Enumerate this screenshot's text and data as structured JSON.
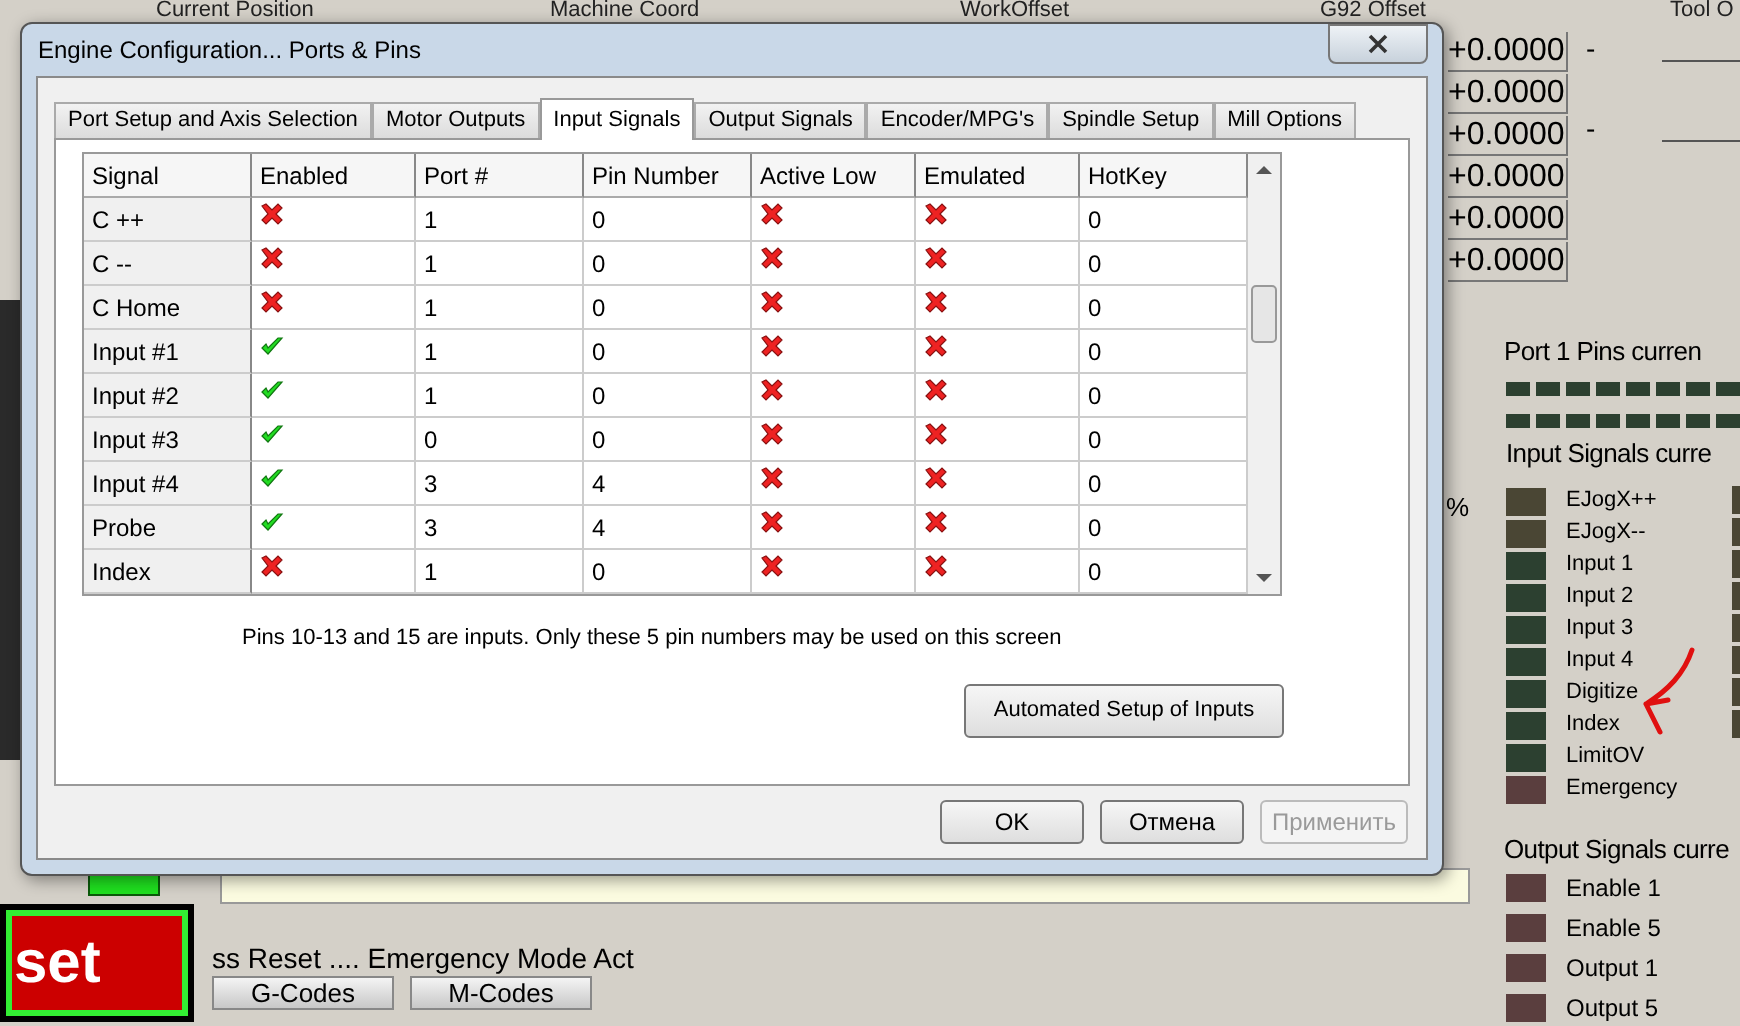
{
  "background_screen": {
    "column_headers": [
      "Current Position",
      "Machine Coord",
      "WorkOffset",
      "G92 Offset",
      "Tool O"
    ],
    "dro_values": [
      "+0.0000",
      "+0.0000",
      "+0.0000",
      "+0.0000",
      "+0.0000",
      "+0.0000"
    ],
    "dashes": [
      "-",
      "-"
    ],
    "port_pins_label": "Port 1 Pins curren",
    "input_signals_label": "Input Signals curre",
    "percent_sign": "%",
    "input_signals": [
      {
        "label": "EJogX++",
        "color": "#4a4634"
      },
      {
        "label": "EJogX--",
        "color": "#4a4634"
      },
      {
        "label": "Input 1",
        "color": "#2c4030"
      },
      {
        "label": "Input 2",
        "color": "#2c4030"
      },
      {
        "label": "Input 3",
        "color": "#2c4030"
      },
      {
        "label": "Input 4",
        "color": "#2c4030"
      },
      {
        "label": "Digitize",
        "color": "#2c4030"
      },
      {
        "label": "Index",
        "color": "#2c4030"
      },
      {
        "label": "LimitOV",
        "color": "#2c4030"
      },
      {
        "label": "Emergency",
        "color": "#5a3e3e"
      }
    ],
    "output_signals_label": "Output Signals curre",
    "output_signals": [
      {
        "label": "Enable 1",
        "color": "#5a3e3e"
      },
      {
        "label": "Enable 5",
        "color": "#5a3e3e"
      },
      {
        "label": "Output 1",
        "color": "#5a3e3e"
      },
      {
        "label": "Output 5",
        "color": "#5a3e3e"
      }
    ],
    "reset_button": "set",
    "status_message": "ss Reset .... Emergency Mode Act",
    "buttons": [
      "G-Codes",
      "M-Codes"
    ]
  },
  "dialog": {
    "title": "Engine Configuration... Ports & Pins",
    "tabs": [
      {
        "label": "Port Setup and Axis Selection",
        "selected": false
      },
      {
        "label": "Motor Outputs",
        "selected": false
      },
      {
        "label": "Input Signals",
        "selected": true
      },
      {
        "label": "Output Signals",
        "selected": false
      },
      {
        "label": "Encoder/MPG's",
        "selected": false
      },
      {
        "label": "Spindle Setup",
        "selected": false
      },
      {
        "label": "Mill Options",
        "selected": false
      }
    ],
    "table": {
      "columns": [
        "Signal",
        "Enabled",
        "Port #",
        "Pin Number",
        "Active Low",
        "Emulated",
        "HotKey"
      ],
      "rows": [
        {
          "signal": "C ++",
          "enabled": false,
          "port": "1",
          "pin": "0",
          "active_low": false,
          "emulated": false,
          "hotkey": "0"
        },
        {
          "signal": "C --",
          "enabled": false,
          "port": "1",
          "pin": "0",
          "active_low": false,
          "emulated": false,
          "hotkey": "0"
        },
        {
          "signal": "C Home",
          "enabled": false,
          "port": "1",
          "pin": "0",
          "active_low": false,
          "emulated": false,
          "hotkey": "0"
        },
        {
          "signal": "Input #1",
          "enabled": true,
          "port": "1",
          "pin": "0",
          "active_low": false,
          "emulated": false,
          "hotkey": "0"
        },
        {
          "signal": "Input #2",
          "enabled": true,
          "port": "1",
          "pin": "0",
          "active_low": false,
          "emulated": false,
          "hotkey": "0"
        },
        {
          "signal": "Input #3",
          "enabled": true,
          "port": "0",
          "pin": "0",
          "active_low": false,
          "emulated": false,
          "hotkey": "0"
        },
        {
          "signal": "Input #4",
          "enabled": true,
          "port": "3",
          "pin": "4",
          "active_low": false,
          "emulated": false,
          "hotkey": "0"
        },
        {
          "signal": "Probe",
          "enabled": true,
          "port": "3",
          "pin": "4",
          "active_low": false,
          "emulated": false,
          "hotkey": "0"
        },
        {
          "signal": "Index",
          "enabled": false,
          "port": "1",
          "pin": "0",
          "active_low": false,
          "emulated": false,
          "hotkey": "0"
        }
      ]
    },
    "note": "Pins 10-13 and 15 are inputs. Only these 5 pin numbers may be used on this screen",
    "automated_button": "Automated Setup of Inputs",
    "buttons": [
      {
        "label": "OK",
        "disabled": false
      },
      {
        "label": "Отмена",
        "disabled": false
      },
      {
        "label": "Применить",
        "disabled": true
      }
    ]
  }
}
